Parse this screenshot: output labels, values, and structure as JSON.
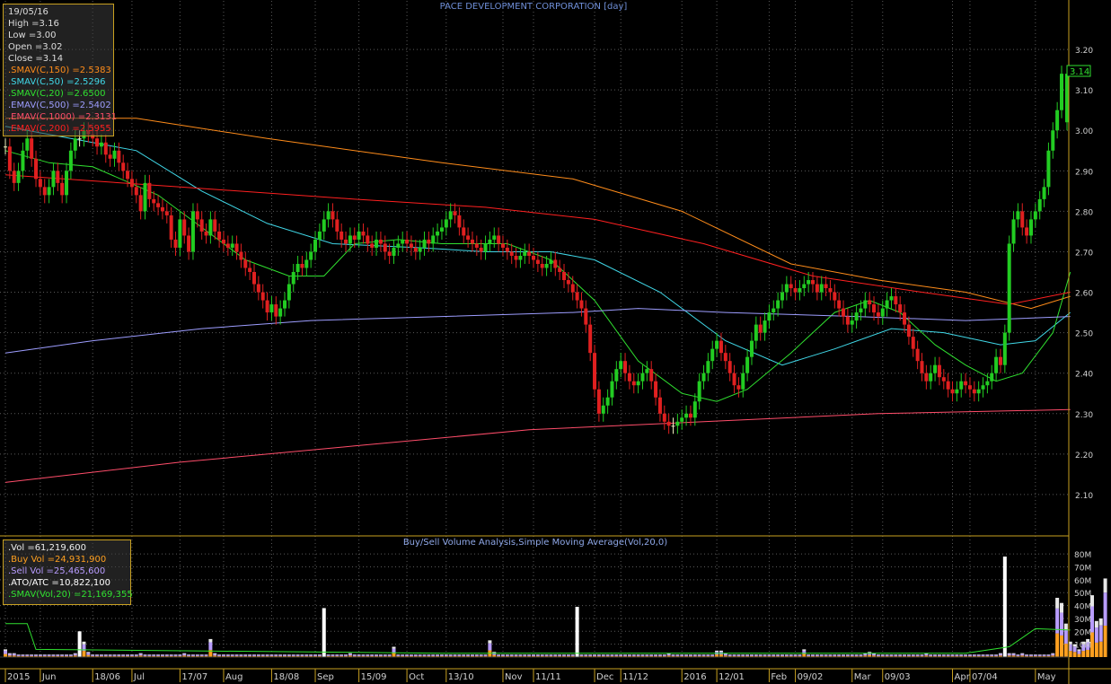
{
  "title": "PACE DEVELOPMENT CORPORATION [day]",
  "volume_title": "Buy/Sell Volume Analysis,Simple Moving Average(Vol,20,0)",
  "price_box": {
    "date": "19/05/16",
    "high": "High =3.16",
    "low": "Low =3.00",
    "open": "Open =3.02",
    "close": "Close =3.14",
    "indicators": [
      {
        "label": ".SMAV(C,150)",
        "value": "=2.5383",
        "color": "#ff8c1a"
      },
      {
        "label": ".SMAV(C,50)",
        "value": "=2.5296",
        "color": "#40d8e8"
      },
      {
        "label": ".SMAV(C,20)",
        "value": "=2.6500",
        "color": "#30e030"
      },
      {
        "label": ".EMAV(C,500)",
        "value": "=2.5402",
        "color": "#9d9dff"
      },
      {
        "label": ".EMAV(C,1000)",
        "value": "=2.3131",
        "color": "#ff4d6a"
      },
      {
        "label": ".EMAV(C,200)",
        "value": "=2.5955",
        "color": "#ff2020"
      }
    ]
  },
  "volume_box": {
    "vol": ".Vol =61,219,600",
    "buy": ".Buy Vol =24,931,900",
    "sell": ".Sell Vol =25,465,600",
    "atoatc": ".ATO/ATC =10,822,100",
    "smav": ".SMAV(Vol,20) =21,169,355"
  },
  "last_price_tag": "3.14",
  "colors": {
    "up": "#22cc22",
    "down": "#e02020",
    "neutral": "#f0f0c0",
    "grid": "#5a5a5a",
    "axis": "#c8a020",
    "text": "#d0d0d0"
  },
  "chart_data": {
    "type": "candlestick",
    "title": "PACE DEVELOPMENT CORPORATION [day]",
    "price_axis": {
      "ticks": [
        2.1,
        2.2,
        2.3,
        2.4,
        2.5,
        2.6,
        2.7,
        2.8,
        2.9,
        3.0,
        3.1,
        3.2
      ],
      "tick_labels": [
        "2.10",
        "2.20",
        "2.30",
        "2.40",
        "2.50",
        "2.60",
        "2.70",
        "2.80",
        "2.90",
        "3.00",
        "3.10",
        "3.20"
      ],
      "range": [
        2.0,
        3.32
      ]
    },
    "volume_axis": {
      "ticks": [
        10,
        20,
        30,
        40,
        50,
        60,
        70,
        80
      ],
      "tick_labels": [
        "10M",
        "20M",
        "30M",
        "40M",
        "50M",
        "60M",
        "70M",
        "80M"
      ],
      "unit": "M",
      "range": [
        0,
        85
      ]
    },
    "date_labels": [
      {
        "label": "2015",
        "index": 0
      },
      {
        "label": "Jun",
        "index": 8
      },
      {
        "label": "18/06",
        "index": 20
      },
      {
        "label": "Jul",
        "index": 29
      },
      {
        "label": "17/07",
        "index": 40
      },
      {
        "label": "Aug",
        "index": 50
      },
      {
        "label": "18/08",
        "index": 61
      },
      {
        "label": "Sep",
        "index": 71
      },
      {
        "label": "15/09",
        "index": 81
      },
      {
        "label": "Oct",
        "index": 92
      },
      {
        "label": "13/10",
        "index": 101
      },
      {
        "label": "Nov",
        "index": 114
      },
      {
        "label": "11/11",
        "index": 121
      },
      {
        "label": "Dec",
        "index": 135
      },
      {
        "label": "11/12",
        "index": 141
      },
      {
        "label": "2016",
        "index": 155
      },
      {
        "label": "12/01",
        "index": 163
      },
      {
        "label": "Feb",
        "index": 175
      },
      {
        "label": "09/02",
        "index": 181
      },
      {
        "label": "Mar",
        "index": 194
      },
      {
        "label": "09/03",
        "index": 201
      },
      {
        "label": "Apr",
        "index": 217
      },
      {
        "label": "07/04",
        "index": 221
      },
      {
        "label": "May",
        "index": 236
      }
    ],
    "closes": [
      2.96,
      2.9,
      2.87,
      2.9,
      2.95,
      2.98,
      2.93,
      2.88,
      2.86,
      2.84,
      2.86,
      2.9,
      2.87,
      2.84,
      2.9,
      2.95,
      2.98,
      2.98,
      3.0,
      2.99,
      2.98,
      2.96,
      2.97,
      2.94,
      2.93,
      2.95,
      2.92,
      2.9,
      2.88,
      2.86,
      2.84,
      2.8,
      2.87,
      2.83,
      2.82,
      2.81,
      2.8,
      2.79,
      2.73,
      2.71,
      2.78,
      2.74,
      2.7,
      2.8,
      2.78,
      2.75,
      2.74,
      2.78,
      2.75,
      2.73,
      2.72,
      2.71,
      2.72,
      2.7,
      2.68,
      2.66,
      2.65,
      2.62,
      2.6,
      2.58,
      2.55,
      2.57,
      2.54,
      2.56,
      2.58,
      2.62,
      2.65,
      2.67,
      2.66,
      2.68,
      2.7,
      2.73,
      2.75,
      2.78,
      2.8,
      2.78,
      2.75,
      2.73,
      2.72,
      2.74,
      2.73,
      2.75,
      2.74,
      2.72,
      2.71,
      2.73,
      2.72,
      2.7,
      2.69,
      2.71,
      2.72,
      2.73,
      2.72,
      2.71,
      2.7,
      2.71,
      2.73,
      2.72,
      2.74,
      2.75,
      2.76,
      2.78,
      2.8,
      2.79,
      2.76,
      2.74,
      2.73,
      2.72,
      2.71,
      2.7,
      2.72,
      2.73,
      2.74,
      2.72,
      2.71,
      2.7,
      2.69,
      2.68,
      2.69,
      2.7,
      2.69,
      2.68,
      2.67,
      2.66,
      2.67,
      2.68,
      2.66,
      2.65,
      2.63,
      2.62,
      2.6,
      2.58,
      2.56,
      2.52,
      2.45,
      2.36,
      2.3,
      2.32,
      2.34,
      2.38,
      2.41,
      2.43,
      2.4,
      2.38,
      2.37,
      2.38,
      2.4,
      2.41,
      2.38,
      2.34,
      2.3,
      2.28,
      2.27,
      2.27,
      2.28,
      2.29,
      2.3,
      2.29,
      2.33,
      2.38,
      2.4,
      2.43,
      2.46,
      2.48,
      2.45,
      2.43,
      2.4,
      2.37,
      2.36,
      2.4,
      2.44,
      2.48,
      2.52,
      2.5,
      2.53,
      2.55,
      2.56,
      2.58,
      2.6,
      2.62,
      2.61,
      2.6,
      2.61,
      2.62,
      2.63,
      2.62,
      2.6,
      2.62,
      2.61,
      2.6,
      2.58,
      2.56,
      2.54,
      2.52,
      2.53,
      2.55,
      2.56,
      2.58,
      2.57,
      2.55,
      2.54,
      2.56,
      2.58,
      2.59,
      2.57,
      2.55,
      2.52,
      2.49,
      2.46,
      2.43,
      2.4,
      2.38,
      2.4,
      2.42,
      2.39,
      2.38,
      2.36,
      2.35,
      2.36,
      2.38,
      2.37,
      2.36,
      2.35,
      2.36,
      2.37,
      2.38,
      2.4,
      2.44,
      2.42,
      2.5,
      2.72,
      2.78,
      2.8,
      2.76,
      2.74,
      2.78,
      2.8,
      2.83,
      2.86,
      2.95,
      3.0,
      3.05,
      3.14
    ],
    "series": [
      {
        "name": "SMAV(C,150)",
        "color": "#ff8c1a",
        "last": 2.5383,
        "values": [
          [
            0,
            3.03
          ],
          [
            30,
            3.03
          ],
          [
            60,
            2.98
          ],
          [
            100,
            2.92
          ],
          [
            130,
            2.88
          ],
          [
            155,
            2.8
          ],
          [
            180,
            2.67
          ],
          [
            200,
            2.63
          ],
          [
            220,
            2.6
          ],
          [
            235,
            2.56
          ],
          [
            244,
            2.59
          ]
        ]
      },
      {
        "name": "SMAV(C,50)",
        "color": "#40d8e8",
        "last": 2.5296,
        "values": [
          [
            0,
            3.01
          ],
          [
            15,
            2.98
          ],
          [
            30,
            2.95
          ],
          [
            45,
            2.85
          ],
          [
            60,
            2.77
          ],
          [
            75,
            2.72
          ],
          [
            95,
            2.71
          ],
          [
            110,
            2.7
          ],
          [
            125,
            2.7
          ],
          [
            135,
            2.68
          ],
          [
            150,
            2.6
          ],
          [
            165,
            2.48
          ],
          [
            178,
            2.42
          ],
          [
            190,
            2.46
          ],
          [
            203,
            2.51
          ],
          [
            215,
            2.5
          ],
          [
            228,
            2.47
          ],
          [
            236,
            2.48
          ],
          [
            244,
            2.55
          ]
        ]
      },
      {
        "name": "SMAV(C,20)",
        "color": "#30e030",
        "last": 2.65,
        "values": [
          [
            0,
            2.95
          ],
          [
            10,
            2.92
          ],
          [
            20,
            2.91
          ],
          [
            35,
            2.84
          ],
          [
            45,
            2.76
          ],
          [
            55,
            2.68
          ],
          [
            65,
            2.64
          ],
          [
            73,
            2.64
          ],
          [
            80,
            2.72
          ],
          [
            90,
            2.73
          ],
          [
            100,
            2.72
          ],
          [
            115,
            2.72
          ],
          [
            125,
            2.68
          ],
          [
            135,
            2.58
          ],
          [
            145,
            2.43
          ],
          [
            155,
            2.35
          ],
          [
            163,
            2.33
          ],
          [
            170,
            2.36
          ],
          [
            180,
            2.45
          ],
          [
            190,
            2.55
          ],
          [
            198,
            2.58
          ],
          [
            205,
            2.55
          ],
          [
            213,
            2.47
          ],
          [
            220,
            2.42
          ],
          [
            227,
            2.38
          ],
          [
            233,
            2.4
          ],
          [
            240,
            2.5
          ],
          [
            244,
            2.65
          ]
        ]
      },
      {
        "name": "EMAV(C,500)",
        "color": "#9d9dff",
        "last": 2.5402,
        "values": [
          [
            0,
            2.45
          ],
          [
            20,
            2.48
          ],
          [
            45,
            2.51
          ],
          [
            70,
            2.53
          ],
          [
            100,
            2.54
          ],
          [
            130,
            2.55
          ],
          [
            145,
            2.56
          ],
          [
            165,
            2.55
          ],
          [
            195,
            2.54
          ],
          [
            220,
            2.53
          ],
          [
            244,
            2.54
          ]
        ]
      },
      {
        "name": "EMAV(C,1000)",
        "color": "#ff4d6a",
        "last": 2.3131,
        "values": [
          [
            0,
            2.13
          ],
          [
            40,
            2.18
          ],
          [
            80,
            2.22
          ],
          [
            120,
            2.26
          ],
          [
            160,
            2.28
          ],
          [
            200,
            2.3
          ],
          [
            244,
            2.31
          ]
        ]
      },
      {
        "name": "EMAV(C,200)",
        "color": "#ff2020",
        "last": 2.5955,
        "values": [
          [
            0,
            2.89
          ],
          [
            40,
            2.86
          ],
          [
            80,
            2.83
          ],
          [
            110,
            2.81
          ],
          [
            135,
            2.78
          ],
          [
            160,
            2.72
          ],
          [
            185,
            2.64
          ],
          [
            210,
            2.6
          ],
          [
            230,
            2.57
          ],
          [
            244,
            2.6
          ]
        ]
      }
    ],
    "volume": {
      "total_m": [
        6,
        3,
        3,
        2,
        2,
        2,
        2,
        2,
        2,
        2,
        2,
        2,
        2,
        2,
        2,
        2,
        3,
        20,
        12,
        4,
        2,
        2,
        2,
        2,
        2,
        2,
        2,
        2,
        2,
        2,
        2,
        3,
        2,
        2,
        2,
        2,
        2,
        2,
        2,
        2,
        2,
        3,
        2,
        2,
        2,
        2,
        2,
        14,
        3,
        2,
        2,
        2,
        2,
        2,
        2,
        2,
        2,
        2,
        2,
        2,
        2,
        2,
        2,
        2,
        2,
        2,
        2,
        2,
        2,
        2,
        2,
        2,
        2,
        38,
        2,
        2,
        2,
        2,
        2,
        3,
        2,
        2,
        2,
        2,
        2,
        2,
        2,
        2,
        2,
        8,
        2,
        2,
        2,
        2,
        2,
        2,
        2,
        2,
        2,
        2,
        2,
        2,
        2,
        2,
        2,
        2,
        2,
        2,
        2,
        2,
        2,
        13,
        4,
        2,
        2,
        2,
        2,
        2,
        2,
        2,
        2,
        2,
        2,
        2,
        2,
        2,
        2,
        2,
        2,
        2,
        2,
        39,
        2,
        2,
        2,
        2,
        2,
        2,
        2,
        2,
        2,
        2,
        2,
        2,
        2,
        2,
        2,
        2,
        2,
        2,
        2,
        2,
        3,
        2,
        2,
        2,
        2,
        2,
        2,
        2,
        2,
        2,
        2,
        5,
        5,
        3,
        2,
        2,
        2,
        2,
        2,
        2,
        2,
        2,
        2,
        2,
        2,
        2,
        2,
        2,
        2,
        2,
        2,
        6,
        2,
        2,
        2,
        2,
        2,
        2,
        2,
        2,
        2,
        2,
        2,
        2,
        2,
        3,
        4,
        3,
        2,
        2,
        2,
        2,
        2,
        2,
        2,
        2,
        2,
        2,
        2,
        3,
        2,
        2,
        2,
        2,
        2,
        2,
        2,
        2,
        2,
        2,
        2,
        2,
        2,
        2,
        2,
        2,
        3,
        78,
        3,
        3,
        2,
        3,
        2,
        2,
        2,
        2,
        2,
        2,
        3,
        46,
        42,
        26,
        12,
        10,
        6,
        12,
        14,
        48,
        28,
        30,
        61
      ],
      "smav_m": [
        [
          0,
          26
        ],
        [
          5,
          26
        ],
        [
          7,
          6
        ],
        [
          100,
          3
        ],
        [
          200,
          3
        ],
        [
          220,
          3
        ],
        [
          230,
          8
        ],
        [
          236,
          22
        ],
        [
          244,
          21
        ]
      ]
    }
  }
}
